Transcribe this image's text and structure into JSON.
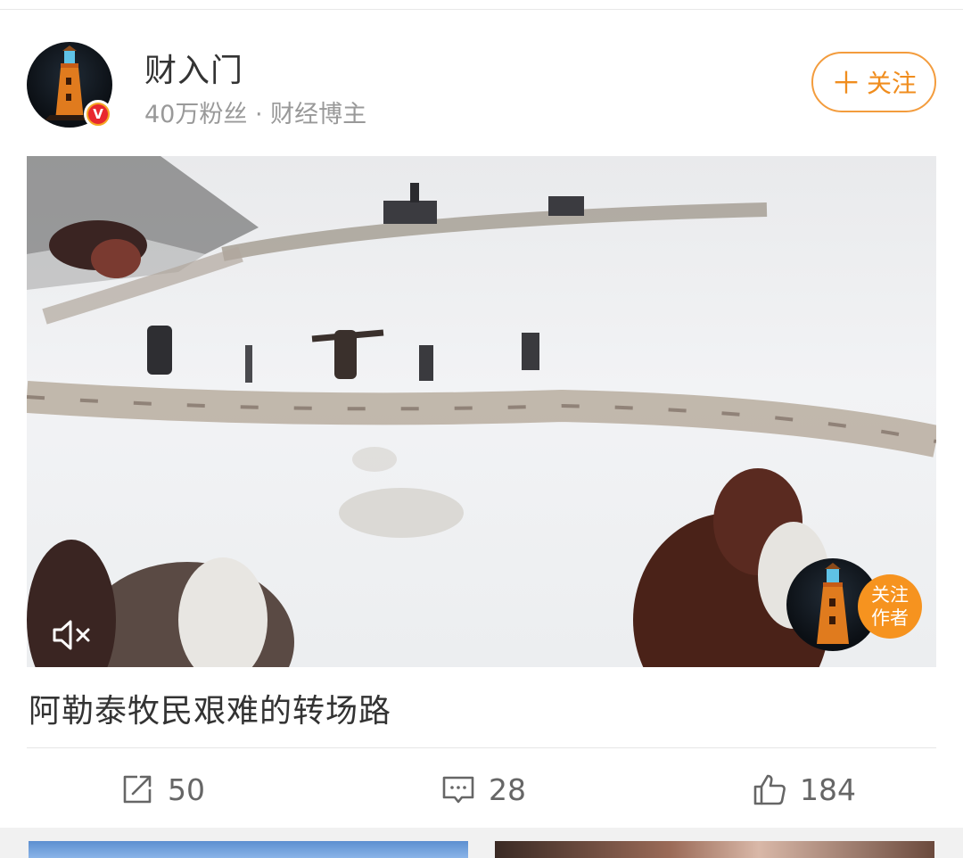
{
  "author": {
    "name": "财入门",
    "meta": "40万粉丝 · 财经博主",
    "verified_badge": "V",
    "follow_label": "关注"
  },
  "video": {
    "muted": true,
    "follow_author_label_line1": "关注",
    "follow_author_label_line2": "作者"
  },
  "post": {
    "title": "阿勒泰牧民艰难的转场路"
  },
  "actions": {
    "repost_count": "50",
    "comment_count": "28",
    "like_count": "184"
  },
  "colors": {
    "accent": "#f08d1e",
    "text_primary": "#333333",
    "text_secondary": "#999999"
  },
  "icons": [
    "lighthouse-avatar",
    "verified-badge",
    "plus-icon",
    "mute-icon",
    "repost-icon",
    "comment-icon",
    "like-icon"
  ]
}
